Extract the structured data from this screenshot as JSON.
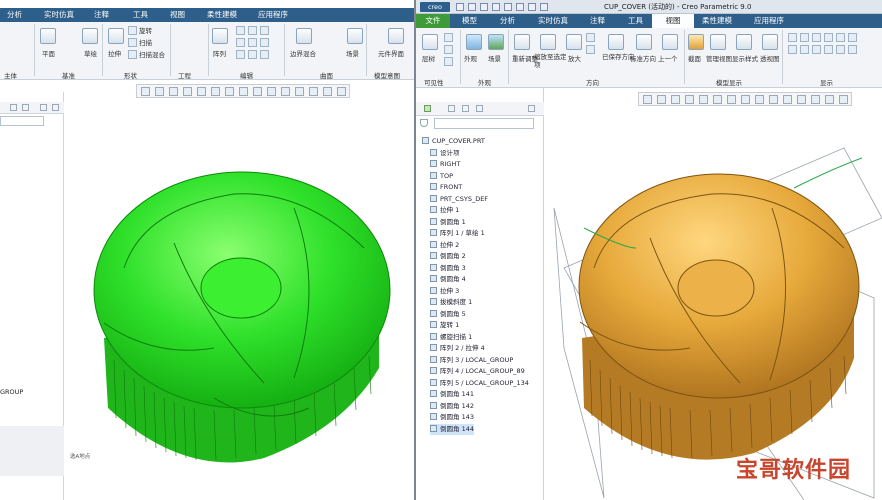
{
  "left_window": {
    "menu": [
      "分析",
      "实时仿真",
      "注释",
      "工具",
      "视图",
      "柔性建模",
      "应用程序"
    ],
    "ribbon_labels": [
      "平面",
      "草绘",
      "拉伸",
      "旋转",
      "扫描",
      "扫描混合",
      "阵列",
      "边界混合",
      "场景",
      "元件界面"
    ],
    "group_labels": [
      "主体",
      "基准",
      "形状",
      "工程",
      "编辑",
      "曲面",
      "模型意图"
    ],
    "tree_fragment": "GROUP",
    "status": "选A地点"
  },
  "right_window": {
    "title": "CUP_COVER (活动的) - Creo Parametric 9.0",
    "logo": "creo",
    "tabs": [
      "文件",
      "模型",
      "分析",
      "实时仿真",
      "注释",
      "工具",
      "视图",
      "柔性建模",
      "应用程序"
    ],
    "active_tab": "视图",
    "ribbon": {
      "items": [
        "层树",
        "外观",
        "场景",
        "重新调整",
        "缩放至选定项",
        "放大",
        "已保存方向",
        "标准方向",
        "上一个",
        "截面",
        "管理视图",
        "显示样式",
        "透视图"
      ],
      "groups": [
        "可见性",
        "外观",
        "方向",
        "模型显示",
        "显示"
      ]
    },
    "tree": {
      "filter_placeholder": "",
      "items": [
        {
          "label": "CUP_COVER.PRT",
          "selected": false,
          "indent": 0
        },
        {
          "label": "设计项",
          "selected": false,
          "indent": 1
        },
        {
          "label": "RIGHT",
          "selected": false,
          "indent": 1
        },
        {
          "label": "TOP",
          "selected": false,
          "indent": 1
        },
        {
          "label": "FRONT",
          "selected": false,
          "indent": 1
        },
        {
          "label": "PRT_CSYS_DEF",
          "selected": false,
          "indent": 1
        },
        {
          "label": "拉伸 1",
          "selected": false,
          "indent": 1
        },
        {
          "label": "倒圆角 1",
          "selected": false,
          "indent": 1
        },
        {
          "label": "阵列 1 / 草绘 1",
          "selected": false,
          "indent": 1
        },
        {
          "label": "拉伸 2",
          "selected": false,
          "indent": 1
        },
        {
          "label": "倒圆角 2",
          "selected": false,
          "indent": 1
        },
        {
          "label": "倒圆角 3",
          "selected": false,
          "indent": 1
        },
        {
          "label": "倒圆角 4",
          "selected": false,
          "indent": 1
        },
        {
          "label": "拉伸 3",
          "selected": false,
          "indent": 1
        },
        {
          "label": "拔模斜度 1",
          "selected": false,
          "indent": 1
        },
        {
          "label": "倒圆角 5",
          "selected": false,
          "indent": 1
        },
        {
          "label": "旋转 1",
          "selected": false,
          "indent": 1
        },
        {
          "label": "螺旋扫描 1",
          "selected": false,
          "indent": 1
        },
        {
          "label": "阵列 2 / 拉伸 4",
          "selected": false,
          "indent": 1
        },
        {
          "label": "阵列 3 / LOCAL_GROUP",
          "selected": false,
          "indent": 1
        },
        {
          "label": "阵列 4 / LOCAL_GROUP_89",
          "selected": false,
          "indent": 1
        },
        {
          "label": "阵列 5 / LOCAL_GROUP_134",
          "selected": false,
          "indent": 1
        },
        {
          "label": "倒圆角 141",
          "selected": false,
          "indent": 1
        },
        {
          "label": "倒圆角 142",
          "selected": false,
          "indent": 1
        },
        {
          "label": "倒圆角 143",
          "selected": false,
          "indent": 1
        },
        {
          "label": "倒圆角 144",
          "selected": true,
          "indent": 1
        }
      ]
    }
  },
  "watermark": "宝哥软件园",
  "colors": {
    "menu_bg": "#2e5f8a",
    "active_tab": "#fbfdfe",
    "green_model": "#2fe12a",
    "gold_model": "#e6a83a",
    "file_tab": "#3f9a3a"
  }
}
